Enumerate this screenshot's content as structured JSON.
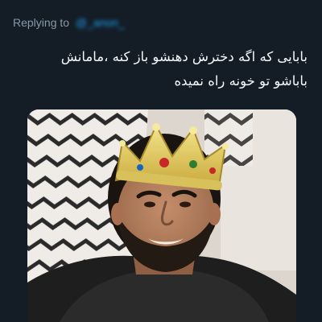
{
  "reply": {
    "prefix": "Replying to",
    "handle": "@_anon_"
  },
  "tweet": {
    "lines": [
      "بابایی که اگه دخترش دهنشو باز کنه ،مامانش",
      "باباشو تو خونه راه نمیده"
    ]
  },
  "media": {
    "description_icon": "photo-icon"
  },
  "colors": {
    "background": "#141d26",
    "text_primary": "#f5f8fa",
    "text_secondary": "#8899a6",
    "accent": "#1da1f2"
  }
}
